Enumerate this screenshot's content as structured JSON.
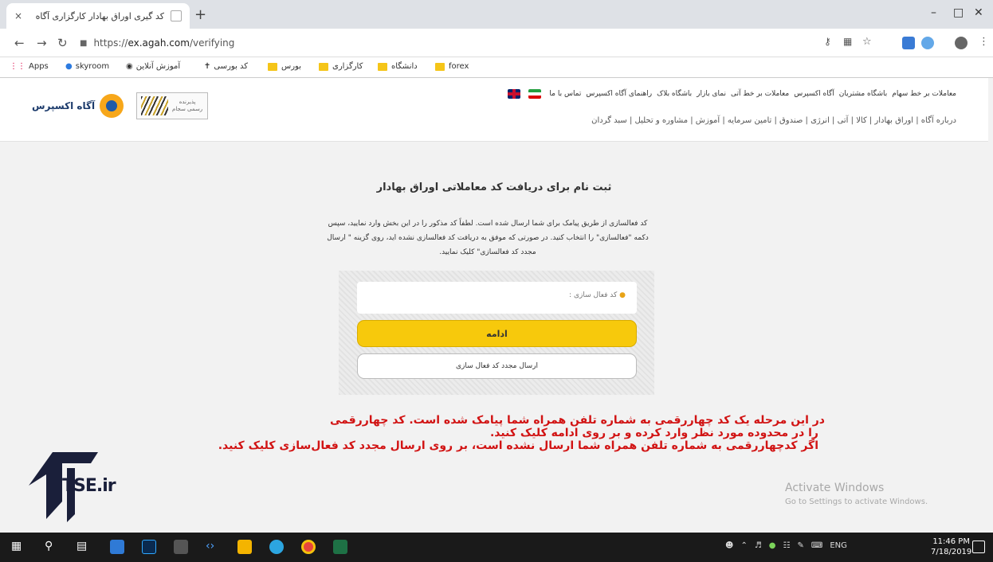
{
  "browser": {
    "tab_title": "کد گیری اوراق بهادار کارگزاری آگاه",
    "tab_close": "×",
    "new_tab": "+",
    "url_scheme": "https://",
    "url_host": "ex.agah.com",
    "url_path": "/verifying",
    "bookmarks": {
      "apps": "Apps",
      "skyroom": "skyroom",
      "online": "آموزش آنلاین",
      "bourse_code": "کد بورسی",
      "bourse": "بورس",
      "kargozari": "کارگزاری",
      "university": "دانشگاه",
      "forex": "forex"
    }
  },
  "site": {
    "logo_text": "آگاه اکسپرس",
    "seal_text": "پذیرنده رسمی سجام",
    "top_links": [
      "معاملات بر خط سهام",
      "باشگاه مشتریان",
      "آگاه اکسپرس",
      "معاملات بر خط آتی",
      "نمای بازار",
      "باشگاه بلاک",
      "راهنمای آگاه اکسپرس",
      "تماس با ما"
    ],
    "nav_links": "درباره آگاه  |  اوراق بهادار  |  کالا  |  آتی  |  انرژی  |  صندوق  |  تامین سرمایه  |  آموزش  |  مشاوره و تحلیل  |  سبد گردان"
  },
  "form": {
    "title": "ثبت نام برای دریافت کد معاملاتی اوراق بهادار",
    "description": "کد فعالسازی از طریق پیامک برای شما ارسال شده است. لطفاً کد مذکور را در این بخش وارد نمایید، سپس دکمه \"فعالسازی\" را انتخاب کنید. در صورتی که موفق به دریافت کد فعالسازی نشده اید، روی گزینه \" ارسال مجدد کد فعالسازی\" کلیک نمایید.",
    "code_label": "کد فعال سازی :",
    "continue": "ادامه",
    "resend": "ارسال مجدد کد فعال سازی"
  },
  "annotation": {
    "line1": "در این مرحله یک کد چهاررقمی به شماره تلفن همراه شما پیامک شده است. کد چهاررقمی",
    "line2": "را در محدوده مورد نظر وارد کرده و بر روی ادامه کلیک کنید.",
    "line3": "اگر کدچهاررقمی به شماره تلفن همراه شما ارسال نشده است، بر روی ارسال مجدد کد فعال‌سازی کلیک کنید."
  },
  "watermark": {
    "text": "TSE.ir"
  },
  "windows": {
    "activate_title": "Activate Windows",
    "activate_sub": "Go to Settings to activate Windows.",
    "lang": "ENG",
    "time": "11:46 PM",
    "date": "7/18/2019"
  },
  "colors": {
    "accent": "#f7c90c",
    "annotation": "#d11313"
  }
}
